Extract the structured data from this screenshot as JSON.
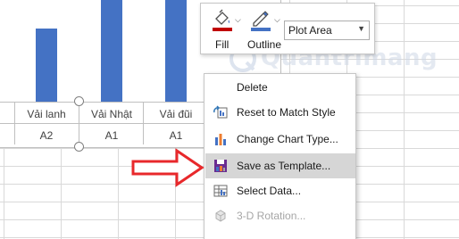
{
  "chart": {
    "categories": [
      {
        "name": "Vải lanh",
        "group": "A2"
      },
      {
        "name": "Vải Nhật",
        "group": "A1"
      },
      {
        "name": "Vải đũi",
        "group": "A1"
      }
    ],
    "bar_color": "#4472c4"
  },
  "toolbar": {
    "fill_label": "Fill",
    "outline_label": "Outline",
    "element_selector": "Plot Area"
  },
  "watermark": {
    "text": "Quantrimang"
  },
  "context_menu": {
    "items": [
      {
        "label": "Delete",
        "icon": "",
        "enabled": true
      },
      {
        "label": "Reset to Match Style",
        "icon": "reset-style-icon",
        "enabled": true
      },
      {
        "label": "Change Chart Type...",
        "icon": "chart-type-icon",
        "enabled": true
      },
      {
        "label": "Save as Template...",
        "icon": "save-template-icon",
        "enabled": true,
        "highlighted": true
      },
      {
        "label": "Select Data...",
        "icon": "select-data-icon",
        "enabled": true
      },
      {
        "label": "3-D Rotation...",
        "icon": "3d-rotation-icon",
        "enabled": false
      }
    ]
  },
  "colors": {
    "accent_red": "#e8282b",
    "highlight": "#d6d6d6"
  }
}
